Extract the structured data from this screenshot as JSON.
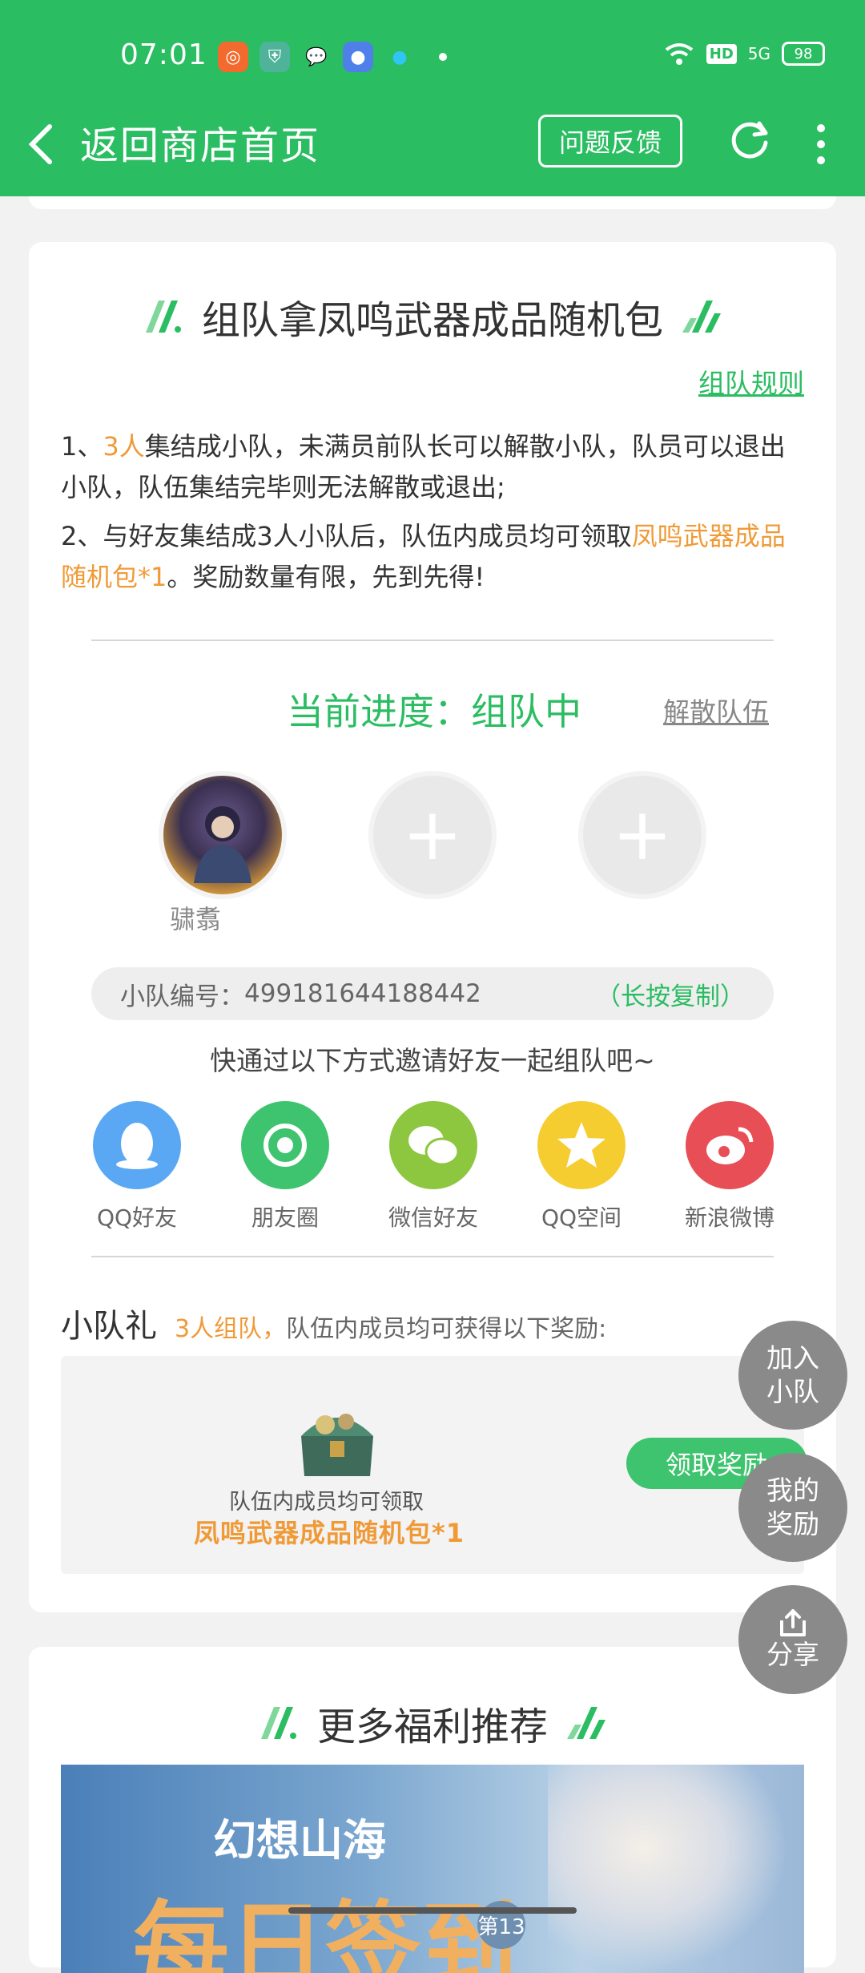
{
  "status_bar": {
    "time": "07:01",
    "battery": "98",
    "hd": "HD",
    "network": "5G"
  },
  "nav": {
    "title": "返回商店首页",
    "feedback_label": "问题反馈"
  },
  "team_card": {
    "title": "组队拿凤鸣武器成品随机包",
    "rules_link": "组队规则",
    "rule1": {
      "num": "1、",
      "highlight": "3人",
      "text": "集结成小队，未满员前队长可以解散小队，队员可以退出小队，队伍集结完毕则无法解散或退出;"
    },
    "rule2": {
      "text": "2、与好友集结成3人小队后，队伍内成员均可领取",
      "highlight": "凤鸣武器成品随机包*1",
      "tail": "。奖励数量有限，先到先得!"
    },
    "progress_label": "当前进度：组队中",
    "disband_label": "解散队伍",
    "members": [
      {
        "name": "骕翥"
      }
    ],
    "team_number_label": "小队编号：",
    "team_number": "499181644188442",
    "copy_hint": "（长按复制）",
    "invite_text": "快通过以下方式邀请好友一起组队吧~",
    "share_options": [
      {
        "label": "QQ好友",
        "icon": "qq-penguin-icon",
        "color": "#5aa8f4"
      },
      {
        "label": "朋友圈",
        "icon": "wechat-moments-icon",
        "color": "#3ec36e"
      },
      {
        "label": "微信好友",
        "icon": "wechat-icon",
        "color": "#8dc63f"
      },
      {
        "label": "QQ空间",
        "icon": "qzone-star-icon",
        "color": "#f6cd30"
      },
      {
        "label": "新浪微博",
        "icon": "weibo-icon",
        "color": "#e84e56"
      }
    ],
    "gift": {
      "title": "小队礼",
      "highlight": "3人组队，",
      "desc": "队伍内成员均可获得以下奖励:",
      "line1": "队伍内成员均可领取",
      "line2": "凤鸣武器成品随机包*1",
      "claim_label": "领取奖励"
    }
  },
  "fabs": {
    "join": [
      "加入",
      "小队"
    ],
    "mine": [
      "我的",
      "奖励"
    ],
    "share": "分享"
  },
  "more_card": {
    "title": "更多福利推荐",
    "banner_title": "幻想山海",
    "banner_big": "每日签到",
    "banner_badge": "第13"
  },
  "colors": {
    "brand_green": "#2bbd62",
    "highlight_orange": "#f09a37",
    "fab_gray": "#8a8a8a"
  }
}
